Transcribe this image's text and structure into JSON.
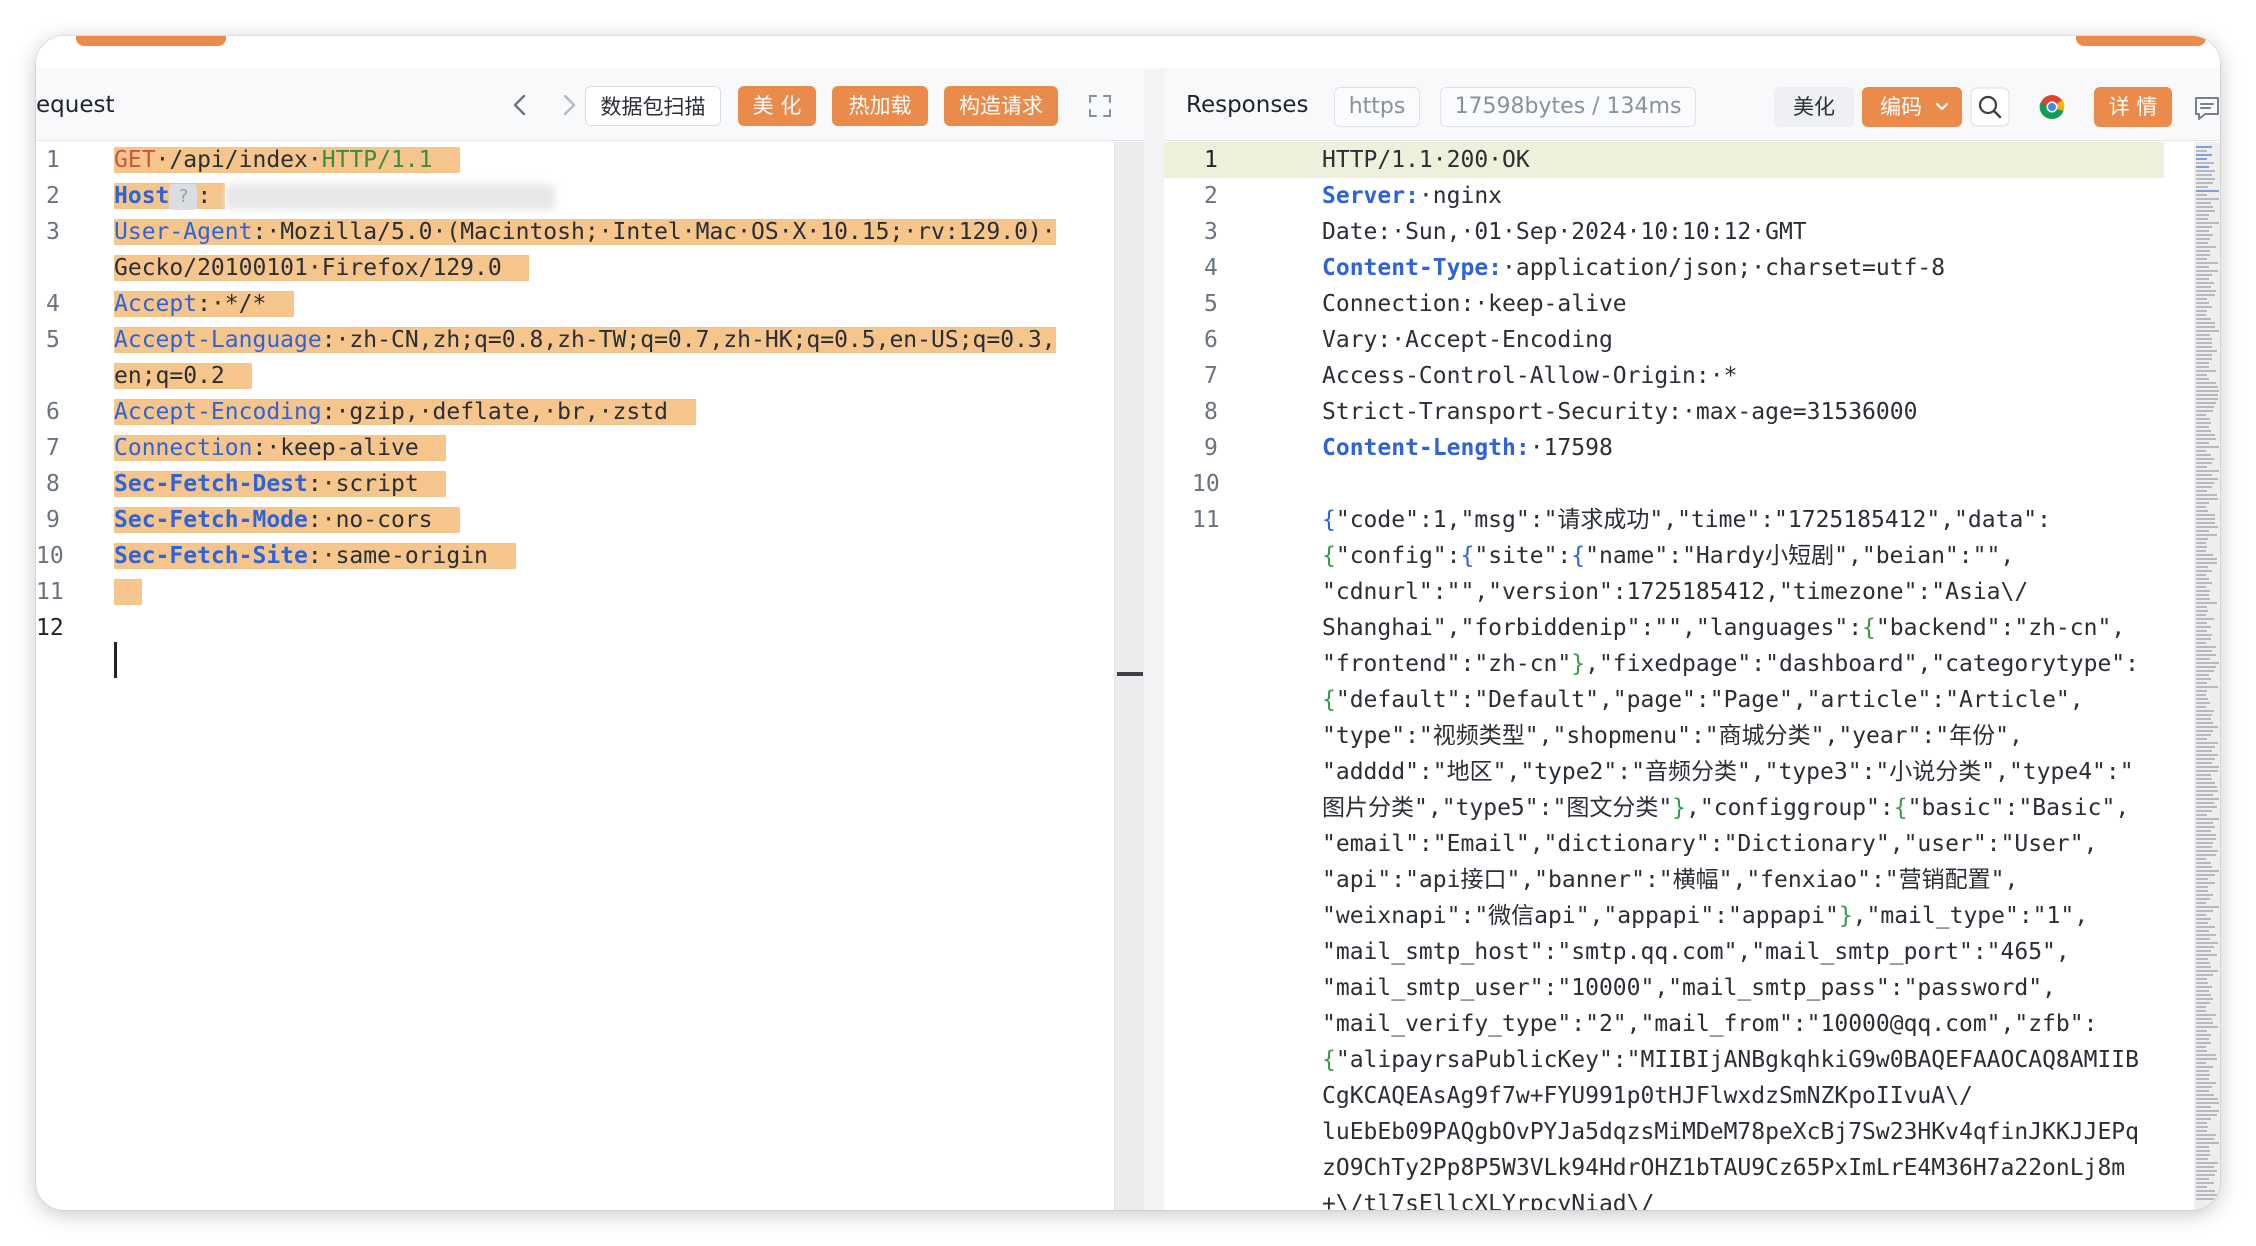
{
  "request": {
    "title": "equest",
    "toolbar": {
      "back_icon": "chevron-left-icon",
      "forward_icon": "chevron-right-icon",
      "scan_label": "数据包扫描",
      "beautify_label": "美 化",
      "hot_reload_label": "热加载",
      "build_request_label": "构造请求",
      "expand_icon": "expand-icon"
    },
    "line_numbers": [
      "1",
      "2",
      "3",
      "",
      "4",
      "5",
      "",
      "6",
      "7",
      "8",
      "9",
      "10",
      "11",
      "12"
    ],
    "lines": {
      "l1_method": "GET",
      "l1_path": "·/api/index·",
      "l1_proto": "HTTP/1.1",
      "l2_key": "Host",
      "l2_q": "?",
      "l3_key": "User-Agent",
      "l3_val": "·Mozilla/5.0·(Macintosh;·Intel·Mac·OS·X·10.15;·rv:129.0)·",
      "l3b_val": "Gecko/20100101·Firefox/129.0",
      "l4_key": "Accept",
      "l4_val": "·*/*",
      "l5_key": "Accept-Language",
      "l5_val": "·zh-CN,zh;q=0.8,zh-TW;q=0.7,zh-HK;q=0.5,en-US;q=0.3,",
      "l5b_val": "en;q=0.2",
      "l6_key": "Accept-Encoding",
      "l6_val": "·gzip,·deflate,·br,·zstd",
      "l7_key": "Connection",
      "l7_val": "·keep-alive",
      "l8_key": "Sec-Fetch-Dest",
      "l8_val": "·script",
      "l9_key": "Sec-Fetch-Mode",
      "l9_val": "·no-cors",
      "l10_key": "Sec-Fetch-Site",
      "l10_val": "·same-origin",
      "colon": ":"
    }
  },
  "response": {
    "title": "Responses",
    "protocol": "https",
    "size_time": "17598bytes / 134ms",
    "beautify_label": "美化",
    "encoding_label": "编码",
    "search_icon": "search-icon",
    "browser_icon": "chrome-icon",
    "details_label": "详 情",
    "comment_icon": "comment-icon",
    "line_numbers": [
      "1",
      "2",
      "3",
      "4",
      "5",
      "6",
      "7",
      "8",
      "9",
      "10",
      "11"
    ],
    "lines": {
      "r1": "HTTP/1.1·200·OK",
      "r2_key": "Server:",
      "r2_val": "·nginx",
      "r3": "Date:·Sun,·01·Sep·2024·10:10:12·GMT",
      "r4_key": "Content-Type:",
      "r4_val": "·application/json;·charset=utf-8",
      "r5": "Connection:·keep-alive",
      "r6": "Vary:·Accept-Encoding",
      "r7": "Access-Control-Allow-Origin:·*",
      "r8": "Strict-Transport-Security:·max-age=31536000",
      "r9_key": "Content-Length:",
      "r9_val": "·17598",
      "b1": "\"code\":1,\"msg\":\"请求成功\",\"time\":\"1725185412\",\"data\":",
      "b2a": "\"config\":",
      "b2b": "\"site\":",
      "b2c": "\"name\":\"Hardy小短剧\",\"beian\":\"\",",
      "b3": "\"cdnurl\":\"\",\"version\":1725185412,\"timezone\":\"Asia\\/",
      "b4a": "Shanghai\",\"forbiddenip\":\"\",\"languages\":",
      "b4b": "\"backend\":\"zh-cn\",",
      "b5a": "\"frontend\":\"zh-cn\"",
      "b5b": ",\"fixedpage\":\"dashboard\",\"categorytype\":",
      "b6": "\"default\":\"Default\",\"page\":\"Page\",\"article\":\"Article\",",
      "b7": "\"type\":\"视频类型\",\"shopmenu\":\"商城分类\",\"year\":\"年份\",",
      "b8": "\"adddd\":\"地区\",\"type2\":\"音频分类\",\"type3\":\"小说分类\",\"type4\":\"",
      "b9a": "图片分类\",\"type5\":\"图文分类\"",
      "b9b": ",\"configgroup\":",
      "b9c": "\"basic\":\"Basic\",",
      "b10": "\"email\":\"Email\",\"dictionary\":\"Dictionary\",\"user\":\"User\",",
      "b11": "\"api\":\"api接口\",\"banner\":\"横幅\",\"fenxiao\":\"营销配置\",",
      "b12a": "\"weixnapi\":\"微信api\",\"appapi\":\"appapi\"",
      "b12b": ",\"mail_type\":\"1\",",
      "b13": "\"mail_smtp_host\":\"smtp.qq.com\",\"mail_smtp_port\":\"465\",",
      "b14": "\"mail_smtp_user\":\"10000\",\"mail_smtp_pass\":\"password\",",
      "b15": "\"mail_verify_type\":\"2\",\"mail_from\":\"10000@qq.com\",\"zfb\":",
      "b16": "\"alipayrsaPublicKey\":\"MIIBIjANBgkqhkiG9w0BAQEFAAOCAQ8AMIIB",
      "b17": "CgKCAQEAsAg9f7w+FYU991p0tHJFlwxdzSmNZKpoIIvuA\\/",
      "b18": "luEbEb09PAQgbOvPYJa5dqzsMiMDeM78peXcBj7Sw23HKv4qfinJKKJJEPq",
      "b19": "zO9ChTy2Pp8P5W3VLk94HdrOHZ1bTAU9Cz65PxImLrE4M36H7a22onLj8m",
      "b20": "+\\/tl7sEllcXLYrpcyNiad\\/",
      "open_brace": "{",
      "close_brace": "}"
    }
  },
  "colors": {
    "accent": "#ea8a4b",
    "selection": "#f5c58c",
    "keyword_blue": "#2e64d8",
    "method_red": "#d25241",
    "protocol_green": "#3b8c3d"
  }
}
